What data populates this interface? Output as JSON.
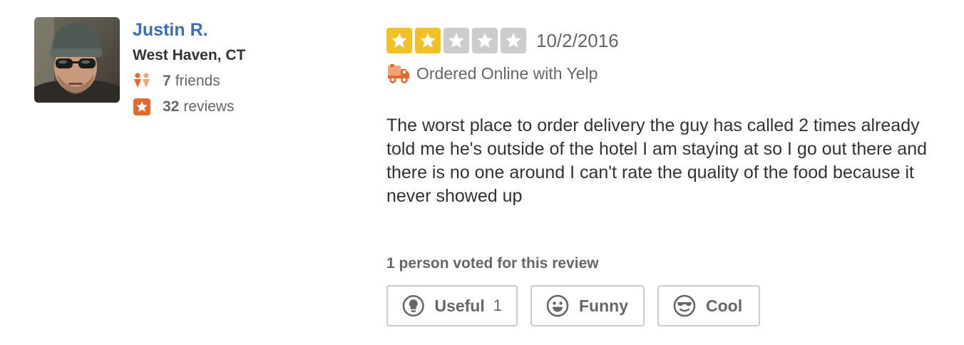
{
  "user": {
    "name": "Justin R.",
    "location": "West Haven, CT",
    "friends_count": "7",
    "friends_label": "friends",
    "reviews_count": "32",
    "reviews_label": "reviews"
  },
  "review": {
    "rating": 2,
    "rating_max": 5,
    "date": "10/2/2016",
    "order_note": "Ordered Online with Yelp",
    "text": "The worst place to order delivery the guy has called 2 times already told me he's outside of the hotel I am staying at so I go out there and there is no one around I can't rate the quality of the food because it never showed up"
  },
  "votes": {
    "summary": "1 person voted for this review",
    "useful_label": "Useful",
    "useful_count": "1",
    "funny_label": "Funny",
    "cool_label": "Cool"
  },
  "colors": {
    "user_link": "#3b70b5",
    "star_filled": "#f0c024",
    "star_empty": "#cccccc",
    "accent_orange": "#e06a2b"
  },
  "icons": {
    "friends": "friends-icon",
    "reviews": "star-badge-icon",
    "order": "delivery-truck-icon",
    "useful": "lightbulb-icon",
    "funny": "smiley-icon",
    "cool": "sunglasses-face-icon"
  }
}
